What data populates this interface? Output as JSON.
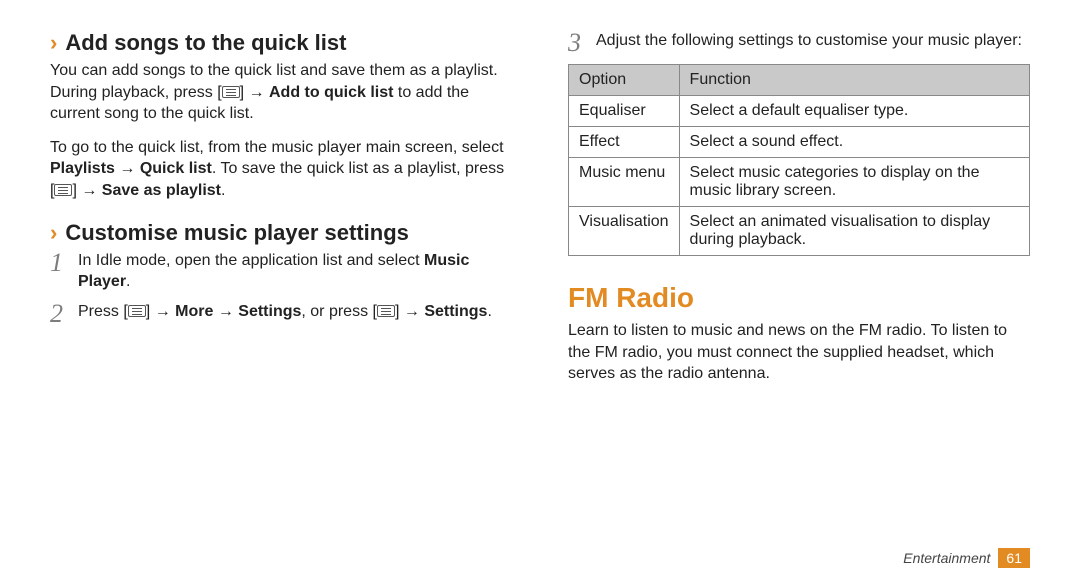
{
  "left": {
    "sec1": {
      "heading": "Add songs to the quick list",
      "p1a": "You can add songs to the quick list and save them as a playlist. During playback, press [",
      "p1b": "] → ",
      "p1bold1": "Add to quick list",
      "p1c": " to add the current song to the quick list.",
      "p2a": "To go to the quick list, from the music player main screen, select ",
      "p2bold1": "Playlists",
      "p2b": " → ",
      "p2bold2": "Quick list",
      "p2c": ". To save the quick list as a playlist, press [",
      "p2d": "] → ",
      "p2bold3": "Save as playlist",
      "p2e": "."
    },
    "sec2": {
      "heading": "Customise music player settings",
      "steps": [
        {
          "num": "1",
          "pre": "In Idle mode, open the application list and select ",
          "bold": "Music Player",
          "post": "."
        },
        {
          "num": "2",
          "a": "Press [",
          "b": "] → ",
          "bold1": "More",
          "c": " → ",
          "bold2": "Settings",
          "d": ", or press [",
          "e": "] → ",
          "bold3": "Settings",
          "f": "."
        }
      ]
    }
  },
  "right": {
    "step3": {
      "num": "3",
      "text": "Adjust the following settings to customise your music player:"
    },
    "table": {
      "headers": [
        "Option",
        "Function"
      ],
      "rows": [
        [
          "Equaliser",
          "Select a default equaliser type."
        ],
        [
          "Effect",
          "Select a sound effect."
        ],
        [
          "Music menu",
          "Select music categories to display on the music library screen."
        ],
        [
          "Visualisation",
          "Select an animated visualisation to display during playback."
        ]
      ]
    },
    "fm": {
      "heading": "FM Radio",
      "p": "Learn to listen to music and news on the FM radio. To listen to the FM radio, you must connect the supplied headset, which serves as the radio antenna."
    }
  },
  "footer": {
    "category": "Entertainment",
    "page": "61"
  }
}
